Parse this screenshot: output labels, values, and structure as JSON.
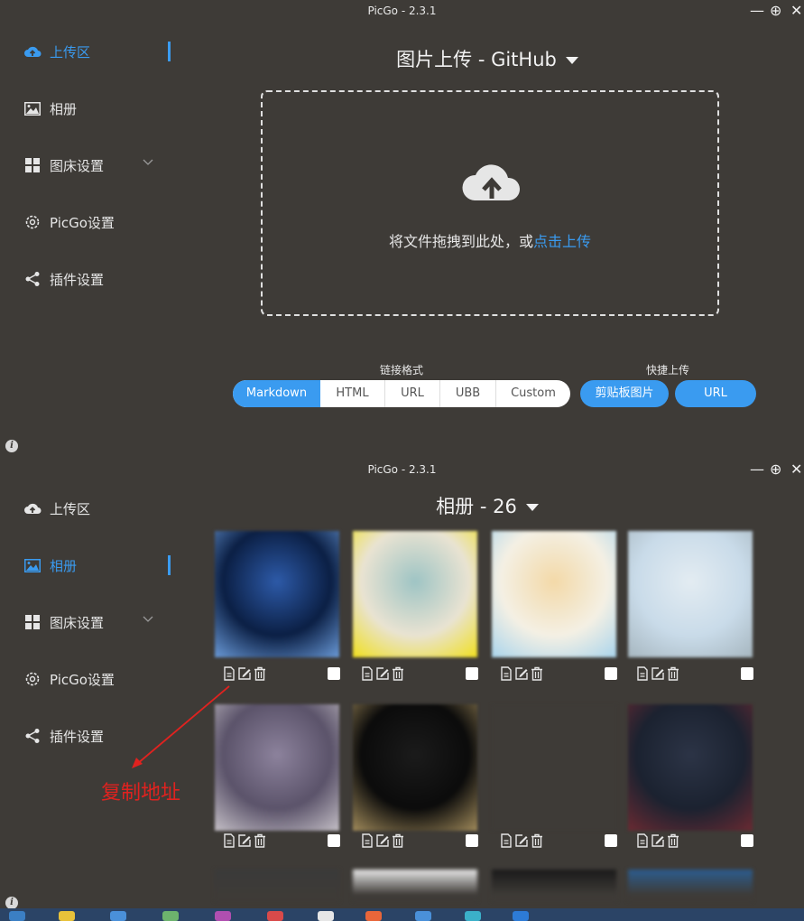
{
  "app_title": "PicGo - 2.3.1",
  "window_controls": {
    "minimize": "—",
    "pin": "⊕",
    "close": "✕"
  },
  "sidebar": {
    "items": [
      {
        "label": "上传区",
        "icon": "cloud-upload-icon"
      },
      {
        "label": "相册",
        "icon": "picture-icon"
      },
      {
        "label": "图床设置",
        "icon": "grid-icon"
      },
      {
        "label": "PicGo设置",
        "icon": "gear-icon"
      },
      {
        "label": "插件设置",
        "icon": "share-icon"
      }
    ]
  },
  "upload_page": {
    "title": "图片上传 - GitHub",
    "drop_text": "将文件拖拽到此处，或",
    "drop_link": "点击上传",
    "link_format_label": "链接格式",
    "link_formats": [
      "Markdown",
      "HTML",
      "URL",
      "UBB",
      "Custom"
    ],
    "selected_format": "Markdown",
    "quick_upload_label": "快捷上传",
    "quick_buttons": [
      "剪贴板图片",
      "URL"
    ]
  },
  "gallery_page": {
    "title": "相册 - 26",
    "thumbnails": [
      {
        "colors": [
          "#0b1f44",
          "#2d5aa8",
          "#6a9ad8"
        ]
      },
      {
        "colors": [
          "#e9e3d2",
          "#9ec4c4",
          "#f0e01e"
        ]
      },
      {
        "colors": [
          "#f4f0e4",
          "#f3d9a8",
          "#a9d4ec"
        ]
      },
      {
        "colors": [
          "#c9dbe9",
          "#e3ecf2",
          "#a6b6bf"
        ]
      },
      {
        "colors": [
          "#5b536a",
          "#8c829c",
          "#c4bfc6"
        ]
      },
      {
        "colors": [
          "#0b0b0b",
          "#1b1b1b",
          "#a08a5a"
        ]
      },
      {
        "colors": [
          "#3e3b37",
          "#3e3b37",
          "#3e3b37"
        ]
      },
      {
        "colors": [
          "#1b2230",
          "#2c3446",
          "#6a2a32"
        ]
      }
    ]
  },
  "annotation": "复制地址"
}
